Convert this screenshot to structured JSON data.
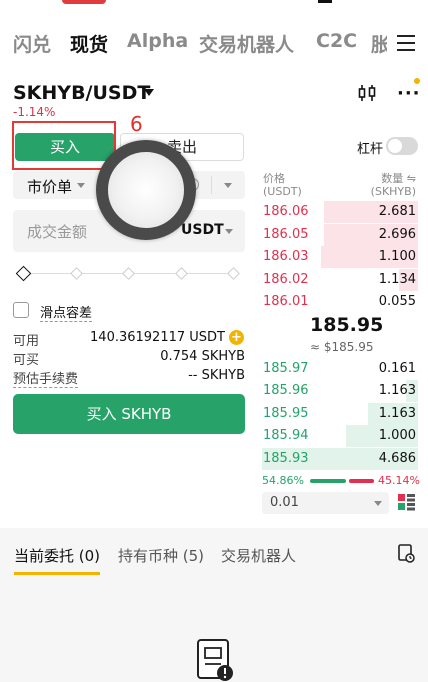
{
  "nav": {
    "tabs": [
      "闪兑",
      "现货",
      "Alpha",
      "交易机器人",
      "C2C",
      "胀"
    ],
    "active_index": 1
  },
  "pair": {
    "symbol": "SKHYB/USDT",
    "change_pct": "-1.14%"
  },
  "trade": {
    "buy_label": "买入",
    "sell_label": "卖出",
    "annotation_number": "6",
    "leverage_label": "杠杆",
    "leverage_on": false,
    "order_type": "市价单",
    "amount_placeholder": "成交金额",
    "amount_unit": "USDT",
    "slippage_label": "滑点容差",
    "available_label": "可用",
    "available_value": "140.36192117 USDT",
    "can_buy_label": "可买",
    "can_buy_value": "0.754 SKHYB",
    "fee_label": "预估手续费",
    "fee_value": "-- SKHYB",
    "buy_button": "买入 SKHYB"
  },
  "orderbook": {
    "price_header": "价格",
    "price_unit": "(USDT)",
    "qty_header": "数量 ⇋",
    "qty_unit": "(SKHYB)",
    "asks": [
      {
        "price": "186.06",
        "qty": "2.681",
        "depth": 0.6
      },
      {
        "price": "186.05",
        "qty": "2.696",
        "depth": 0.6
      },
      {
        "price": "186.03",
        "qty": "1.100",
        "depth": 0.62
      },
      {
        "price": "186.02",
        "qty": "1.134",
        "depth": 0.12
      },
      {
        "price": "186.01",
        "qty": "0.055",
        "depth": 0.0
      }
    ],
    "last_price": "185.95",
    "last_price_fiat": "≈ $185.95",
    "bids": [
      {
        "price": "185.97",
        "qty": "0.161",
        "depth": 0.0
      },
      {
        "price": "185.96",
        "qty": "1.163",
        "depth": 0.08
      },
      {
        "price": "185.95",
        "qty": "1.163",
        "depth": 0.32
      },
      {
        "price": "185.94",
        "qty": "1.000",
        "depth": 0.46
      },
      {
        "price": "185.93",
        "qty": "4.686",
        "depth": 1.0
      }
    ],
    "buy_ratio": "54.86%",
    "sell_ratio": "45.14%",
    "precision": "0.01"
  },
  "bottom": {
    "tabs": [
      "当前委托 (0)",
      "持有币种 (5)",
      "交易机器人"
    ]
  },
  "colors": {
    "buy": "#27a36a",
    "sell": "#e0304e",
    "accent": "#f3b400"
  }
}
